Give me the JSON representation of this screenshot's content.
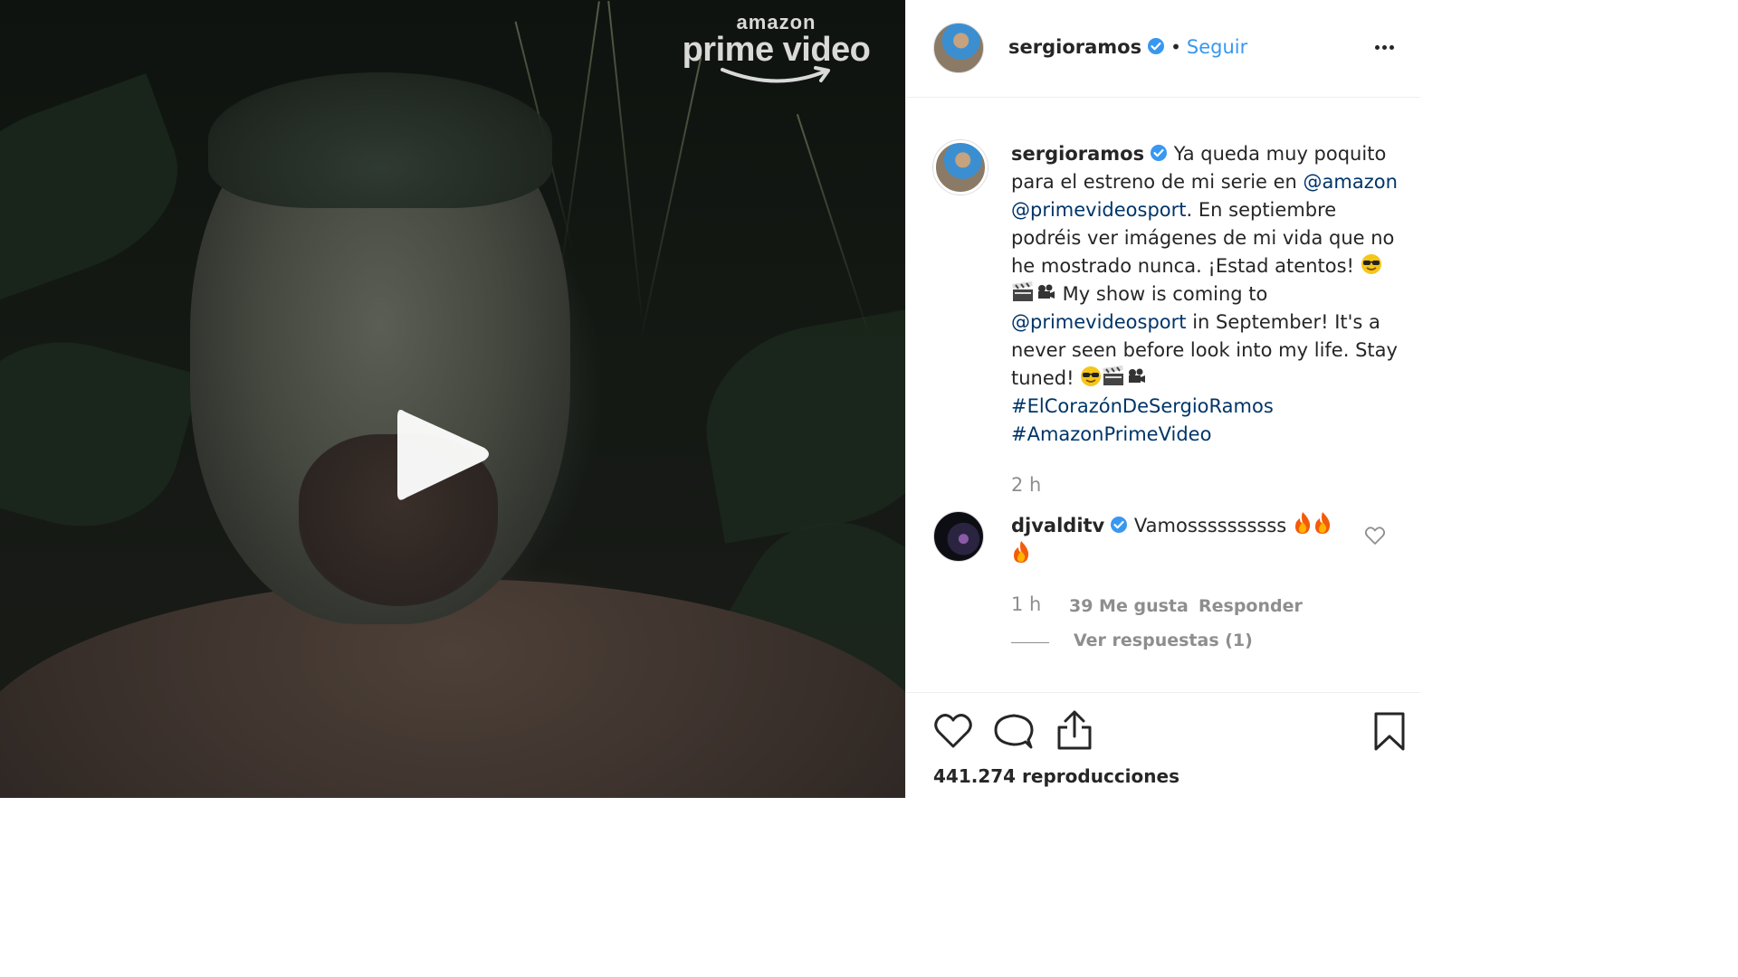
{
  "video": {
    "logo_top": "amazon",
    "logo_main": "prime video"
  },
  "header": {
    "username": "sergioramos",
    "separator": "•",
    "follow_label": "Seguir"
  },
  "caption": {
    "username": "sergioramos",
    "text_1": " Ya queda muy poquito para el estreno de mi serie en ",
    "mention_1": "@amazon",
    "mention_2": "@primevideosport",
    "text_2": ". En septiembre podréis ver imágenes de mi vida que no he mostrado nunca. ¡Estad atentos! ",
    "text_3": " My show is coming to ",
    "mention_3": "@primevideosport",
    "text_4": " in September! It's a never seen before look into my life. Stay tuned! ",
    "hashtag_1": "#ElCorazónDeSergioRamos",
    "hashtag_2": "#AmazonPrimeVideo",
    "time": "2 h"
  },
  "comment": {
    "username": "djvalditv",
    "text": " Vamossssssssss ",
    "time": "1 h",
    "likes": "39 Me gusta",
    "reply_label": "Responder",
    "view_replies": "Ver respuestas (1)"
  },
  "footer": {
    "views": "441.274 reproducciones"
  },
  "colors": {
    "link": "#003569",
    "follow": "#3897f0",
    "verified": "#3897f0",
    "muted": "#8e8e8e"
  }
}
